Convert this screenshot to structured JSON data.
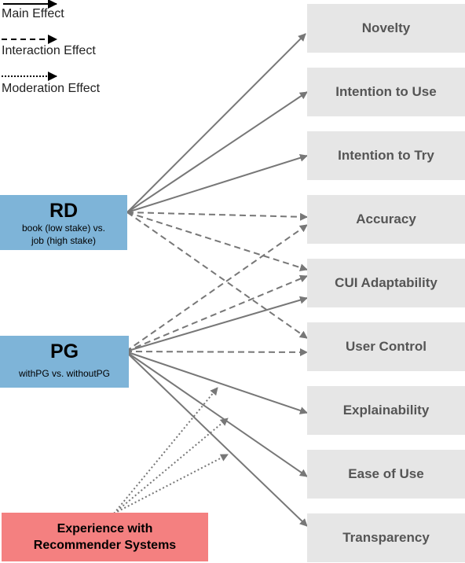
{
  "legend": [
    {
      "label": "Main Effect",
      "style": "solid"
    },
    {
      "label": "Interaction Effect",
      "style": "dashed"
    },
    {
      "label": "Moderation Effect",
      "style": "dotted"
    }
  ],
  "factors": {
    "rd": {
      "title": "RD",
      "subtitle_line1": "book (low stake) vs.",
      "subtitle_line2": "job (high stake)"
    },
    "pg": {
      "title": "PG",
      "subtitle": "withPG vs. withoutPG"
    }
  },
  "moderator": {
    "line1": "Experience with",
    "line2": "Recommender Systems"
  },
  "outcomes": [
    "Novelty",
    "Intention to Use",
    "Intention to Try",
    "Accuracy",
    "CUI Adaptability",
    "User Control",
    "Explainability",
    "Ease of Use",
    "Transparency"
  ],
  "edges": [
    {
      "from": "RD",
      "to": "Novelty",
      "type": "main"
    },
    {
      "from": "RD",
      "to": "Intention to Use",
      "type": "main"
    },
    {
      "from": "RD",
      "to": "Intention to Try",
      "type": "main"
    },
    {
      "from": "RD",
      "to": "Accuracy",
      "type": "interaction"
    },
    {
      "from": "RD",
      "to": "CUI Adaptability",
      "type": "interaction"
    },
    {
      "from": "RD",
      "to": "User Control",
      "type": "interaction"
    },
    {
      "from": "PG",
      "to": "Accuracy",
      "type": "interaction"
    },
    {
      "from": "PG",
      "to": "CUI Adaptability",
      "type": "interaction"
    },
    {
      "from": "PG",
      "to": "CUI Adaptability",
      "type": "main"
    },
    {
      "from": "PG",
      "to": "User Control",
      "type": "interaction"
    },
    {
      "from": "PG",
      "to": "Explainability",
      "type": "main"
    },
    {
      "from": "PG",
      "to": "Ease of Use",
      "type": "main"
    },
    {
      "from": "PG",
      "to": "Transparency",
      "type": "main"
    },
    {
      "from": "Experience with Recommender Systems",
      "to": "PG→Explainability",
      "type": "moderation"
    },
    {
      "from": "Experience with Recommender Systems",
      "to": "PG→Ease of Use",
      "type": "moderation"
    },
    {
      "from": "Experience with Recommender Systems",
      "to": "PG→Transparency",
      "type": "moderation"
    }
  ],
  "colors": {
    "arrow": "#777777",
    "factor_box": "#7eb4d8",
    "moderator_box": "#f48080",
    "outcome_box": "#e6e6e6",
    "outcome_text": "#555555"
  }
}
